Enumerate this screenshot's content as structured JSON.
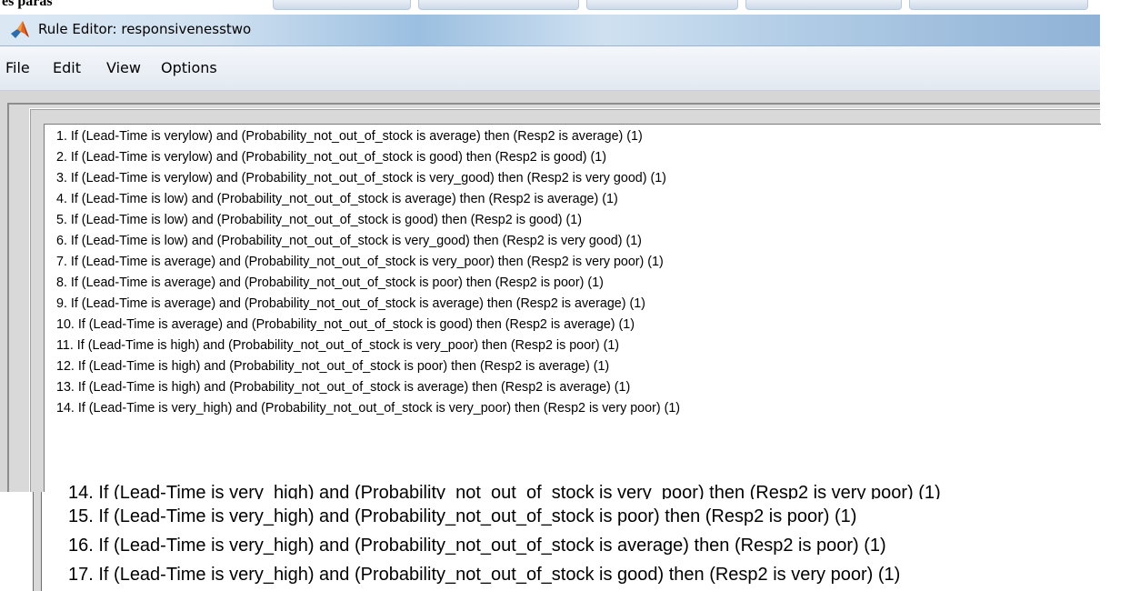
{
  "cropped_top_label": "es paras",
  "window": {
    "title": "Rule Editor: responsivenesstwo"
  },
  "menu": {
    "items": [
      "File",
      "Edit",
      "View",
      "Options"
    ]
  },
  "rules": [
    "1. If (Lead-Time is verylow) and (Probability_not_out_of_stock is average) then (Resp2 is average) (1)",
    "2. If (Lead-Time is verylow) and (Probability_not_out_of_stock is good) then (Resp2 is good) (1)",
    "3. If (Lead-Time is verylow) and (Probability_not_out_of_stock is very_good) then (Resp2 is very good) (1)",
    "4. If (Lead-Time is low) and (Probability_not_out_of_stock is average) then (Resp2 is average) (1)",
    "5. If (Lead-Time is low) and (Probability_not_out_of_stock is good) then (Resp2 is good) (1)",
    "6. If (Lead-Time is low) and (Probability_not_out_of_stock is very_good) then (Resp2 is very good) (1)",
    "7. If (Lead-Time is average) and (Probability_not_out_of_stock is very_poor) then (Resp2 is very poor) (1)",
    "8. If (Lead-Time is average) and (Probability_not_out_of_stock is poor) then (Resp2 is poor) (1)",
    "9. If (Lead-Time is average) and (Probability_not_out_of_stock is average) then (Resp2 is average) (1)",
    "10. If (Lead-Time is average) and (Probability_not_out_of_stock is good) then (Resp2 is average) (1)",
    "11. If (Lead-Time is high) and (Probability_not_out_of_stock is very_poor) then (Resp2 is poor) (1)",
    "12. If (Lead-Time is high) and (Probability_not_out_of_stock is poor) then (Resp2 is average) (1)",
    "13. If (Lead-Time is high) and (Probability_not_out_of_stock is average) then (Resp2 is average) (1)",
    "14. If (Lead-Time is very_high) and (Probability_not_out_of_stock is very_poor) then (Resp2 is very poor) (1)"
  ],
  "zoomed_rules": [
    "14. If (Lead-Time is very_high) and (Probability_not_out_of_stock is very_poor) then (Resp2 is very poor) (1)",
    "15. If (Lead-Time is very_high) and (Probability_not_out_of_stock is poor) then (Resp2 is poor) (1)",
    "16. If (Lead-Time is very_high) and (Probability_not_out_of_stock is average) then (Resp2 is poor) (1)",
    "17. If (Lead-Time is very_high) and (Probability_not_out_of_stock is good) then (Resp2 is very poor) (1)"
  ],
  "icons": {
    "app": "matlab-logo-icon"
  }
}
